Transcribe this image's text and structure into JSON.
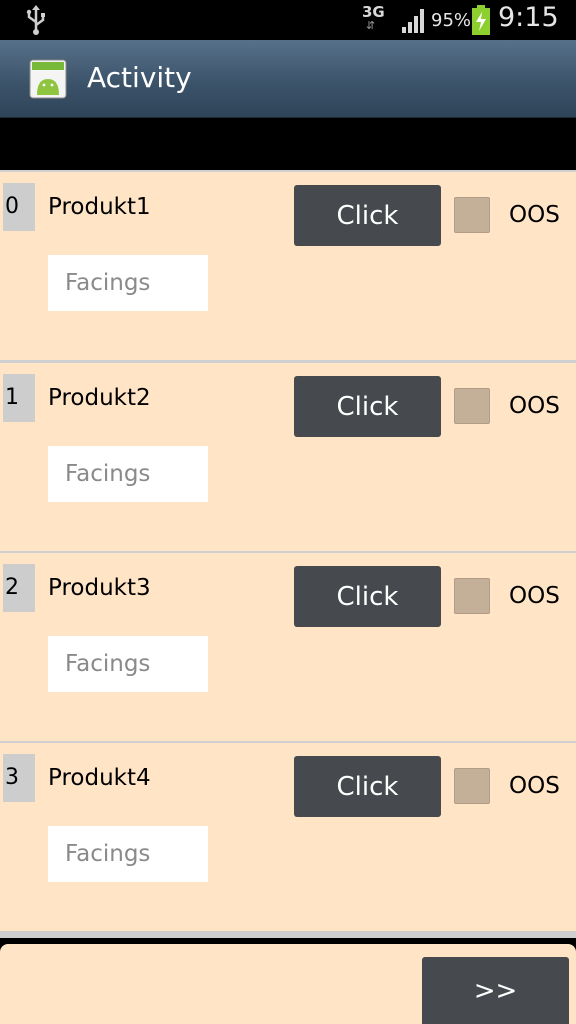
{
  "status_bar": {
    "network_type": "3G",
    "battery_percent": "95%",
    "clock": "9:15",
    "icons": [
      "usb-icon",
      "signal-icon",
      "battery-charging-icon"
    ]
  },
  "action_bar": {
    "title": "Activity",
    "icon": "android-app-icon"
  },
  "rows": [
    {
      "index": "0",
      "name": "Produkt1",
      "facings_placeholder": "Facings",
      "button_label": "Click",
      "oos_label": "OOS",
      "oos_checked": false
    },
    {
      "index": "1",
      "name": "Produkt2",
      "facings_placeholder": "Facings",
      "button_label": "Click",
      "oos_label": "OOS",
      "oos_checked": false
    },
    {
      "index": "2",
      "name": "Produkt3",
      "facings_placeholder": "Facings",
      "button_label": "Click",
      "oos_label": "OOS",
      "oos_checked": false
    },
    {
      "index": "3",
      "name": "Produkt4",
      "facings_placeholder": "Facings",
      "button_label": "Click",
      "oos_label": "OOS",
      "oos_checked": false
    }
  ],
  "footer": {
    "next_label": ">>"
  },
  "colors": {
    "row_background": "#ffe4c6",
    "button_background": "#46494d",
    "checkbox_fill": "#c4af99",
    "index_badge": "#cdcdcd",
    "action_bar": "#3a5268"
  }
}
